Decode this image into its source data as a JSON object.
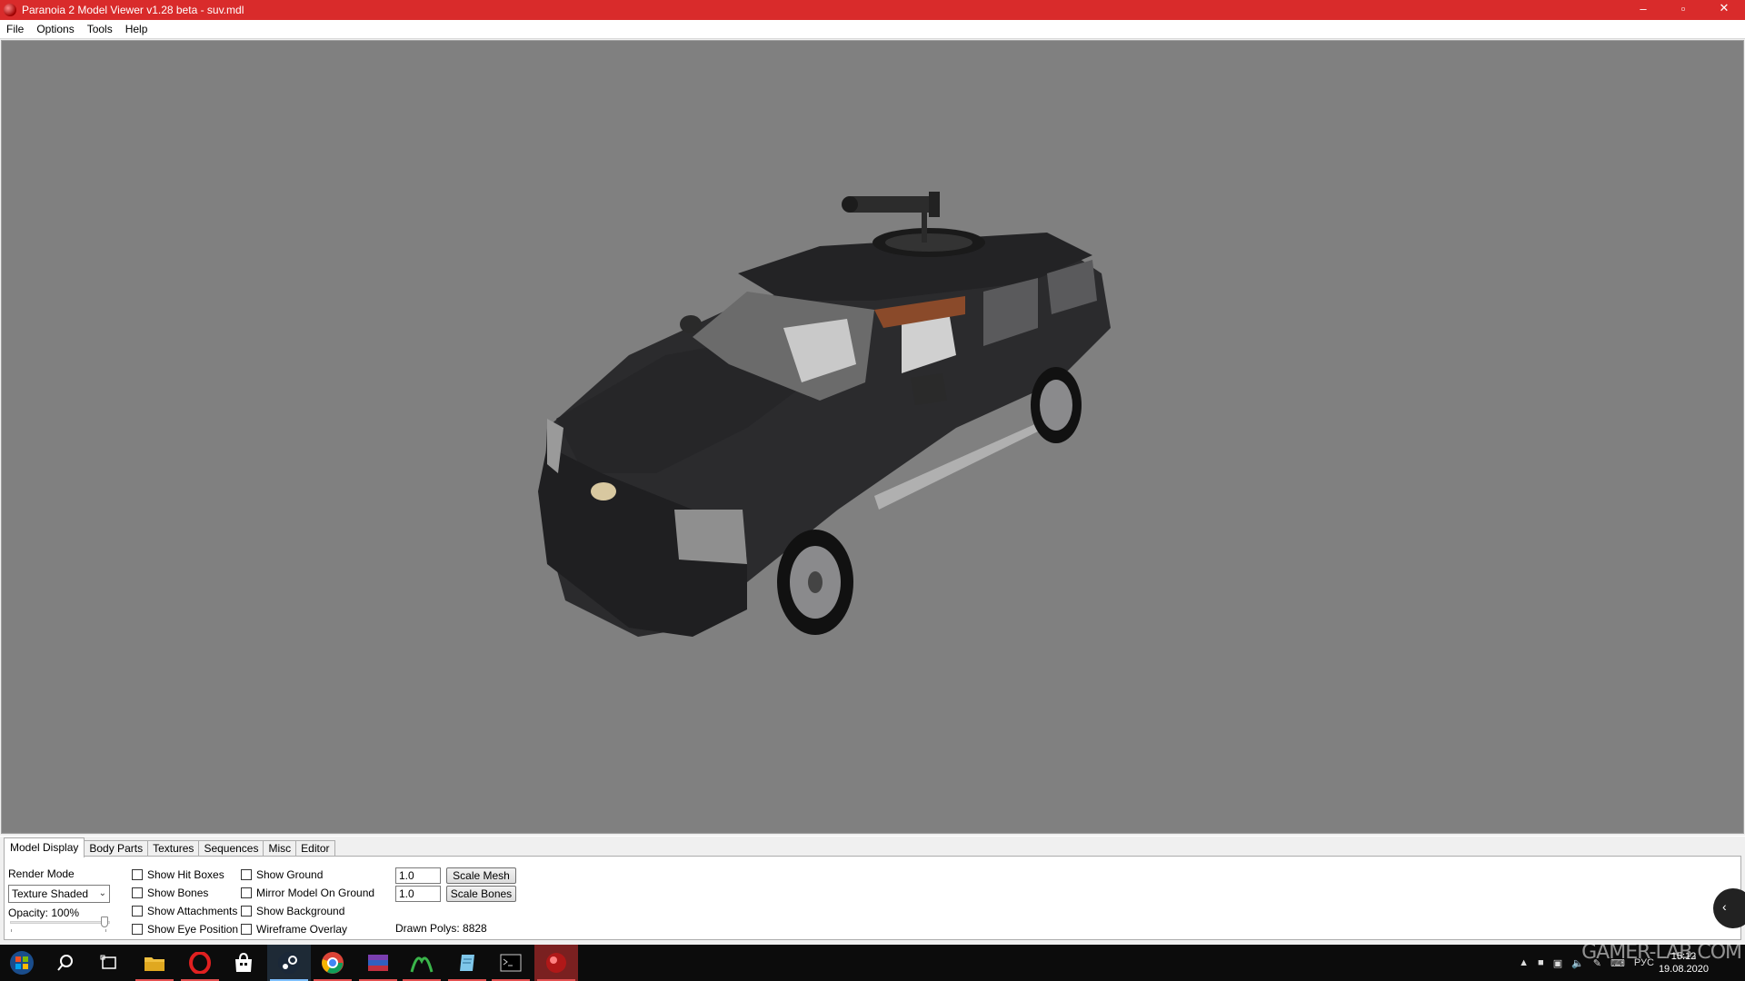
{
  "window": {
    "title": "Paranoia 2 Model Viewer v1.28 beta - suv.mdl",
    "controls": {
      "minimize": "–",
      "maximize": "▫",
      "close": "✕"
    }
  },
  "menu": [
    "File",
    "Options",
    "Tools",
    "Help"
  ],
  "tabs": [
    "Model Display",
    "Body Parts",
    "Textures",
    "Sequences",
    "Misc",
    "Editor"
  ],
  "model_display": {
    "render_mode_label": "Render Mode",
    "render_mode_value": "Texture Shaded",
    "opacity_label": "Opacity: 100%",
    "opacity_value": 1.0,
    "checkboxes_col1": [
      "Show Hit Boxes",
      "Show Bones",
      "Show Attachments",
      "Show Eye Position"
    ],
    "checkboxes_col2": [
      "Show Ground",
      "Mirror Model On Ground",
      "Show Background",
      "Wireframe Overlay"
    ],
    "scale_mesh_value": "1.0",
    "scale_bones_value": "1.0",
    "scale_mesh_button": "Scale Mesh",
    "scale_bones_button": "Scale Bones",
    "drawn_polys": "Drawn Polys: 8828"
  },
  "taskbar": {
    "icons": [
      "start-icon",
      "search-icon",
      "task-view-icon",
      "file-explorer-icon",
      "opera-icon",
      "store-icon",
      "steam-icon",
      "chrome-icon",
      "archiver-icon",
      "green-app-icon",
      "notepad-icon",
      "terminal-icon",
      "paranoia-viewer-icon"
    ],
    "tray": {
      "lang": "РУС",
      "time": "15:12",
      "date": "19.08.2020"
    }
  },
  "colors": {
    "titlebar": "#d92b2b",
    "viewport": "#808080",
    "taskbar": "#0c0c0c"
  },
  "watermark": "GAMER-LAB.COM"
}
